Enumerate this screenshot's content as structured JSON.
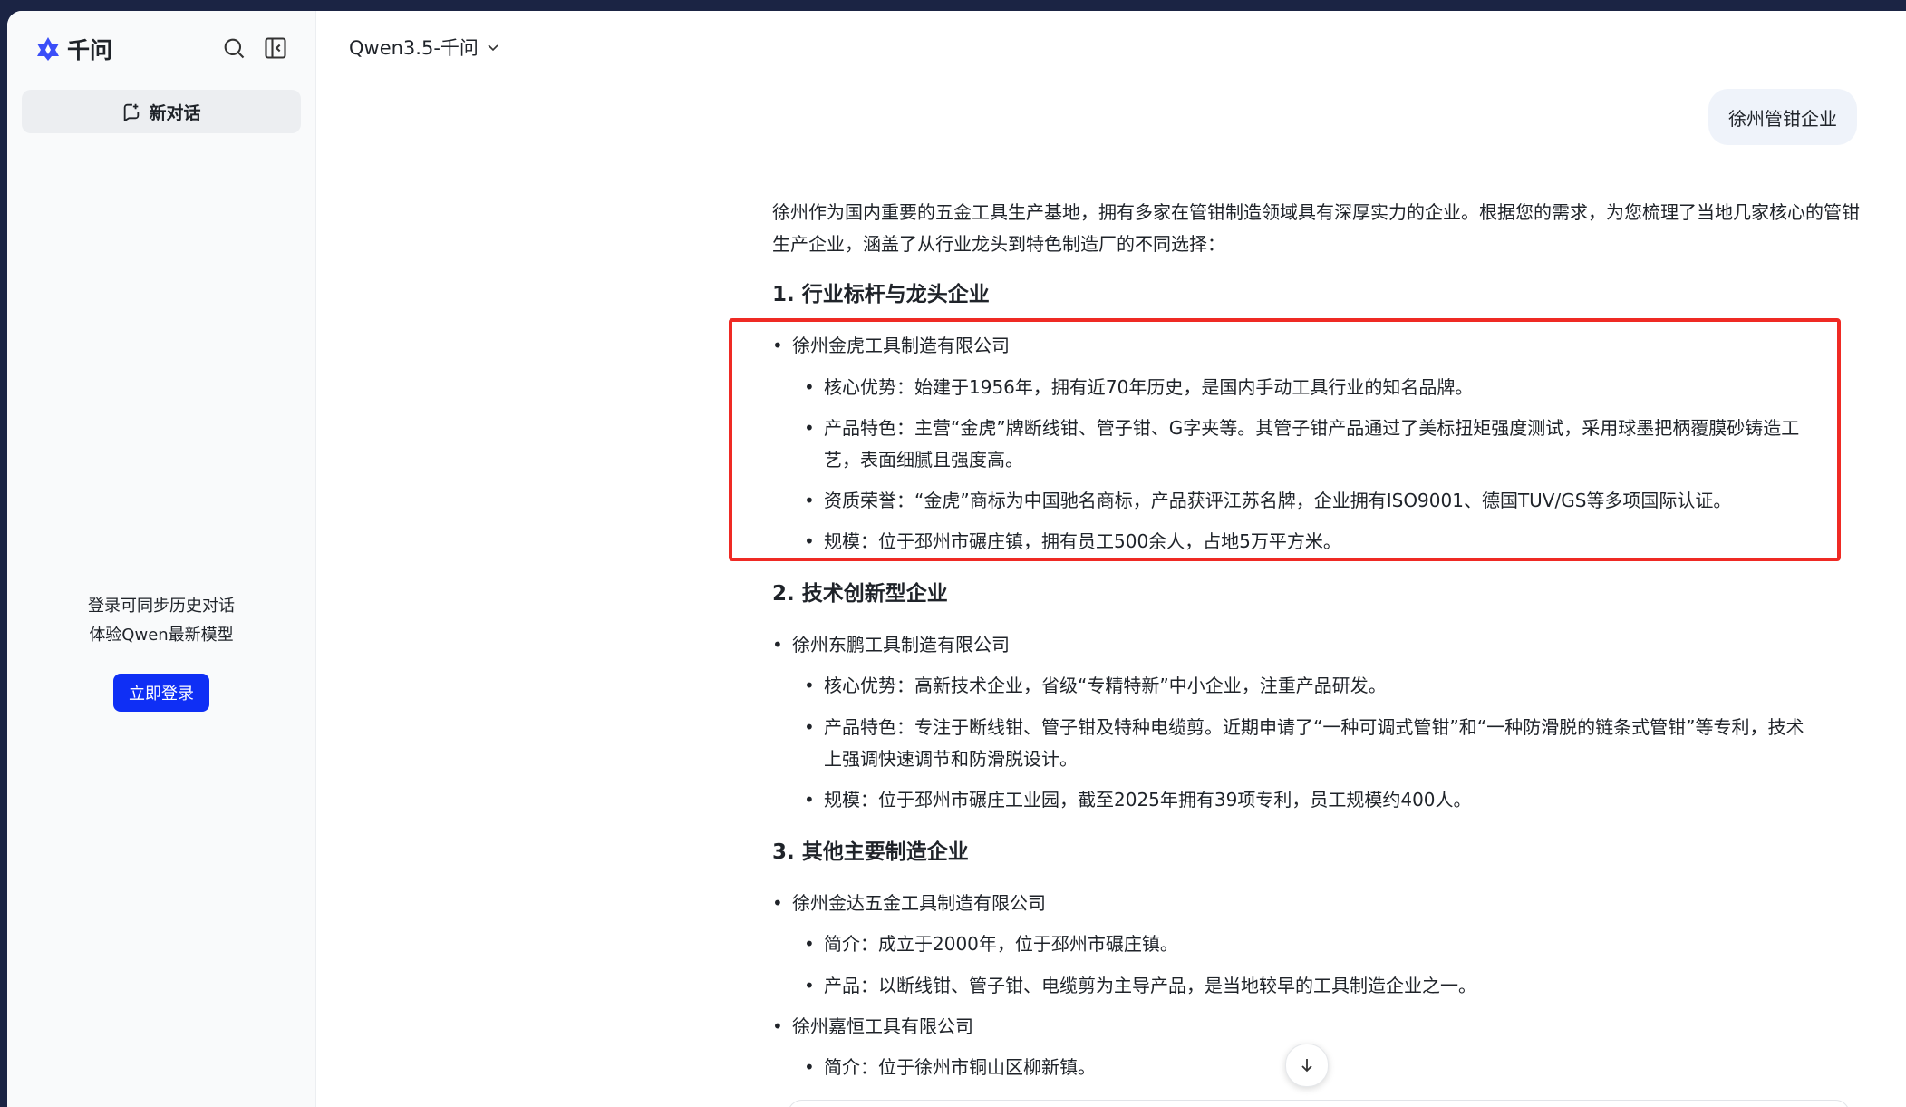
{
  "sidebar": {
    "logo_text": "千问",
    "new_chat_label": "新对话",
    "login_hint_line1": "登录可同步历史对话",
    "login_hint_line2": "体验Qwen最新模型",
    "login_button": "立即登录"
  },
  "header": {
    "model_name": "Qwen3.5-千问"
  },
  "conversation": {
    "user_message": "徐州管钳企业",
    "intro": "徐州作为国内重要的五金工具生产基地，拥有多家在管钳制造领域具有深厚实力的企业。根据您的需求，为您梳理了当地几家核心的管钳生产企业，涵盖了从行业龙头到特色制造厂的不同选择：",
    "sections": [
      {
        "title": "1. 行业标杆与龙头企业",
        "company": "徐州金虎工具制造有限公司",
        "details": [
          "核心优势：始建于1956年，拥有近70年历史，是国内手动工具行业的知名品牌。",
          "产品特色：主营“金虎”牌断线钳、管子钳、G字夹等。其管子钳产品通过了美标扭矩强度测试，采用球墨把柄覆膜砂铸造工艺，表面细腻且强度高。",
          "资质荣誉：“金虎”商标为中国驰名商标，产品获评江苏名牌，企业拥有ISO9001、德国TUV/GS等多项国际认证。",
          "规模：位于邳州市碾庄镇，拥有员工500余人，占地5万平方米。"
        ]
      },
      {
        "title": "2. 技术创新型企业",
        "company": "徐州东鹏工具制造有限公司",
        "details": [
          "核心优势：高新技术企业，省级“专精特新”中小企业，注重产品研发。",
          "产品特色：专注于断线钳、管子钳及特种电缆剪。近期申请了“一种可调式管钳”和“一种防滑脱的链条式管钳”等专利，技术上强调快速调节和防滑脱设计。",
          "规模：位于邳州市碾庄工业园，截至2025年拥有39项专利，员工规模约400人。"
        ]
      },
      {
        "title": "3. 其他主要制造企业",
        "company": "徐州金达五金工具制造有限公司",
        "details": [
          "简介：成立于2000年，位于邳州市碾庄镇。",
          "产品：以断线钳、管子钳、电缆剪为主导产品，是当地较早的工具制造企业之一。"
        ],
        "company2": "徐州嘉恒工具有限公司",
        "details2": [
          "简介：位于徐州市铜山区柳新镇。"
        ]
      }
    ]
  },
  "colors": {
    "primary": "#0f2ff5",
    "highlight_box": "#ef2a24",
    "sidebar_bg": "#f9fafb",
    "bubble_bg": "#eff3fa"
  },
  "icons": [
    "qwen-logo-icon",
    "search-icon",
    "sidebar-collapse-icon",
    "new-chat-icon",
    "chevron-down-icon",
    "arrow-down-icon"
  ]
}
